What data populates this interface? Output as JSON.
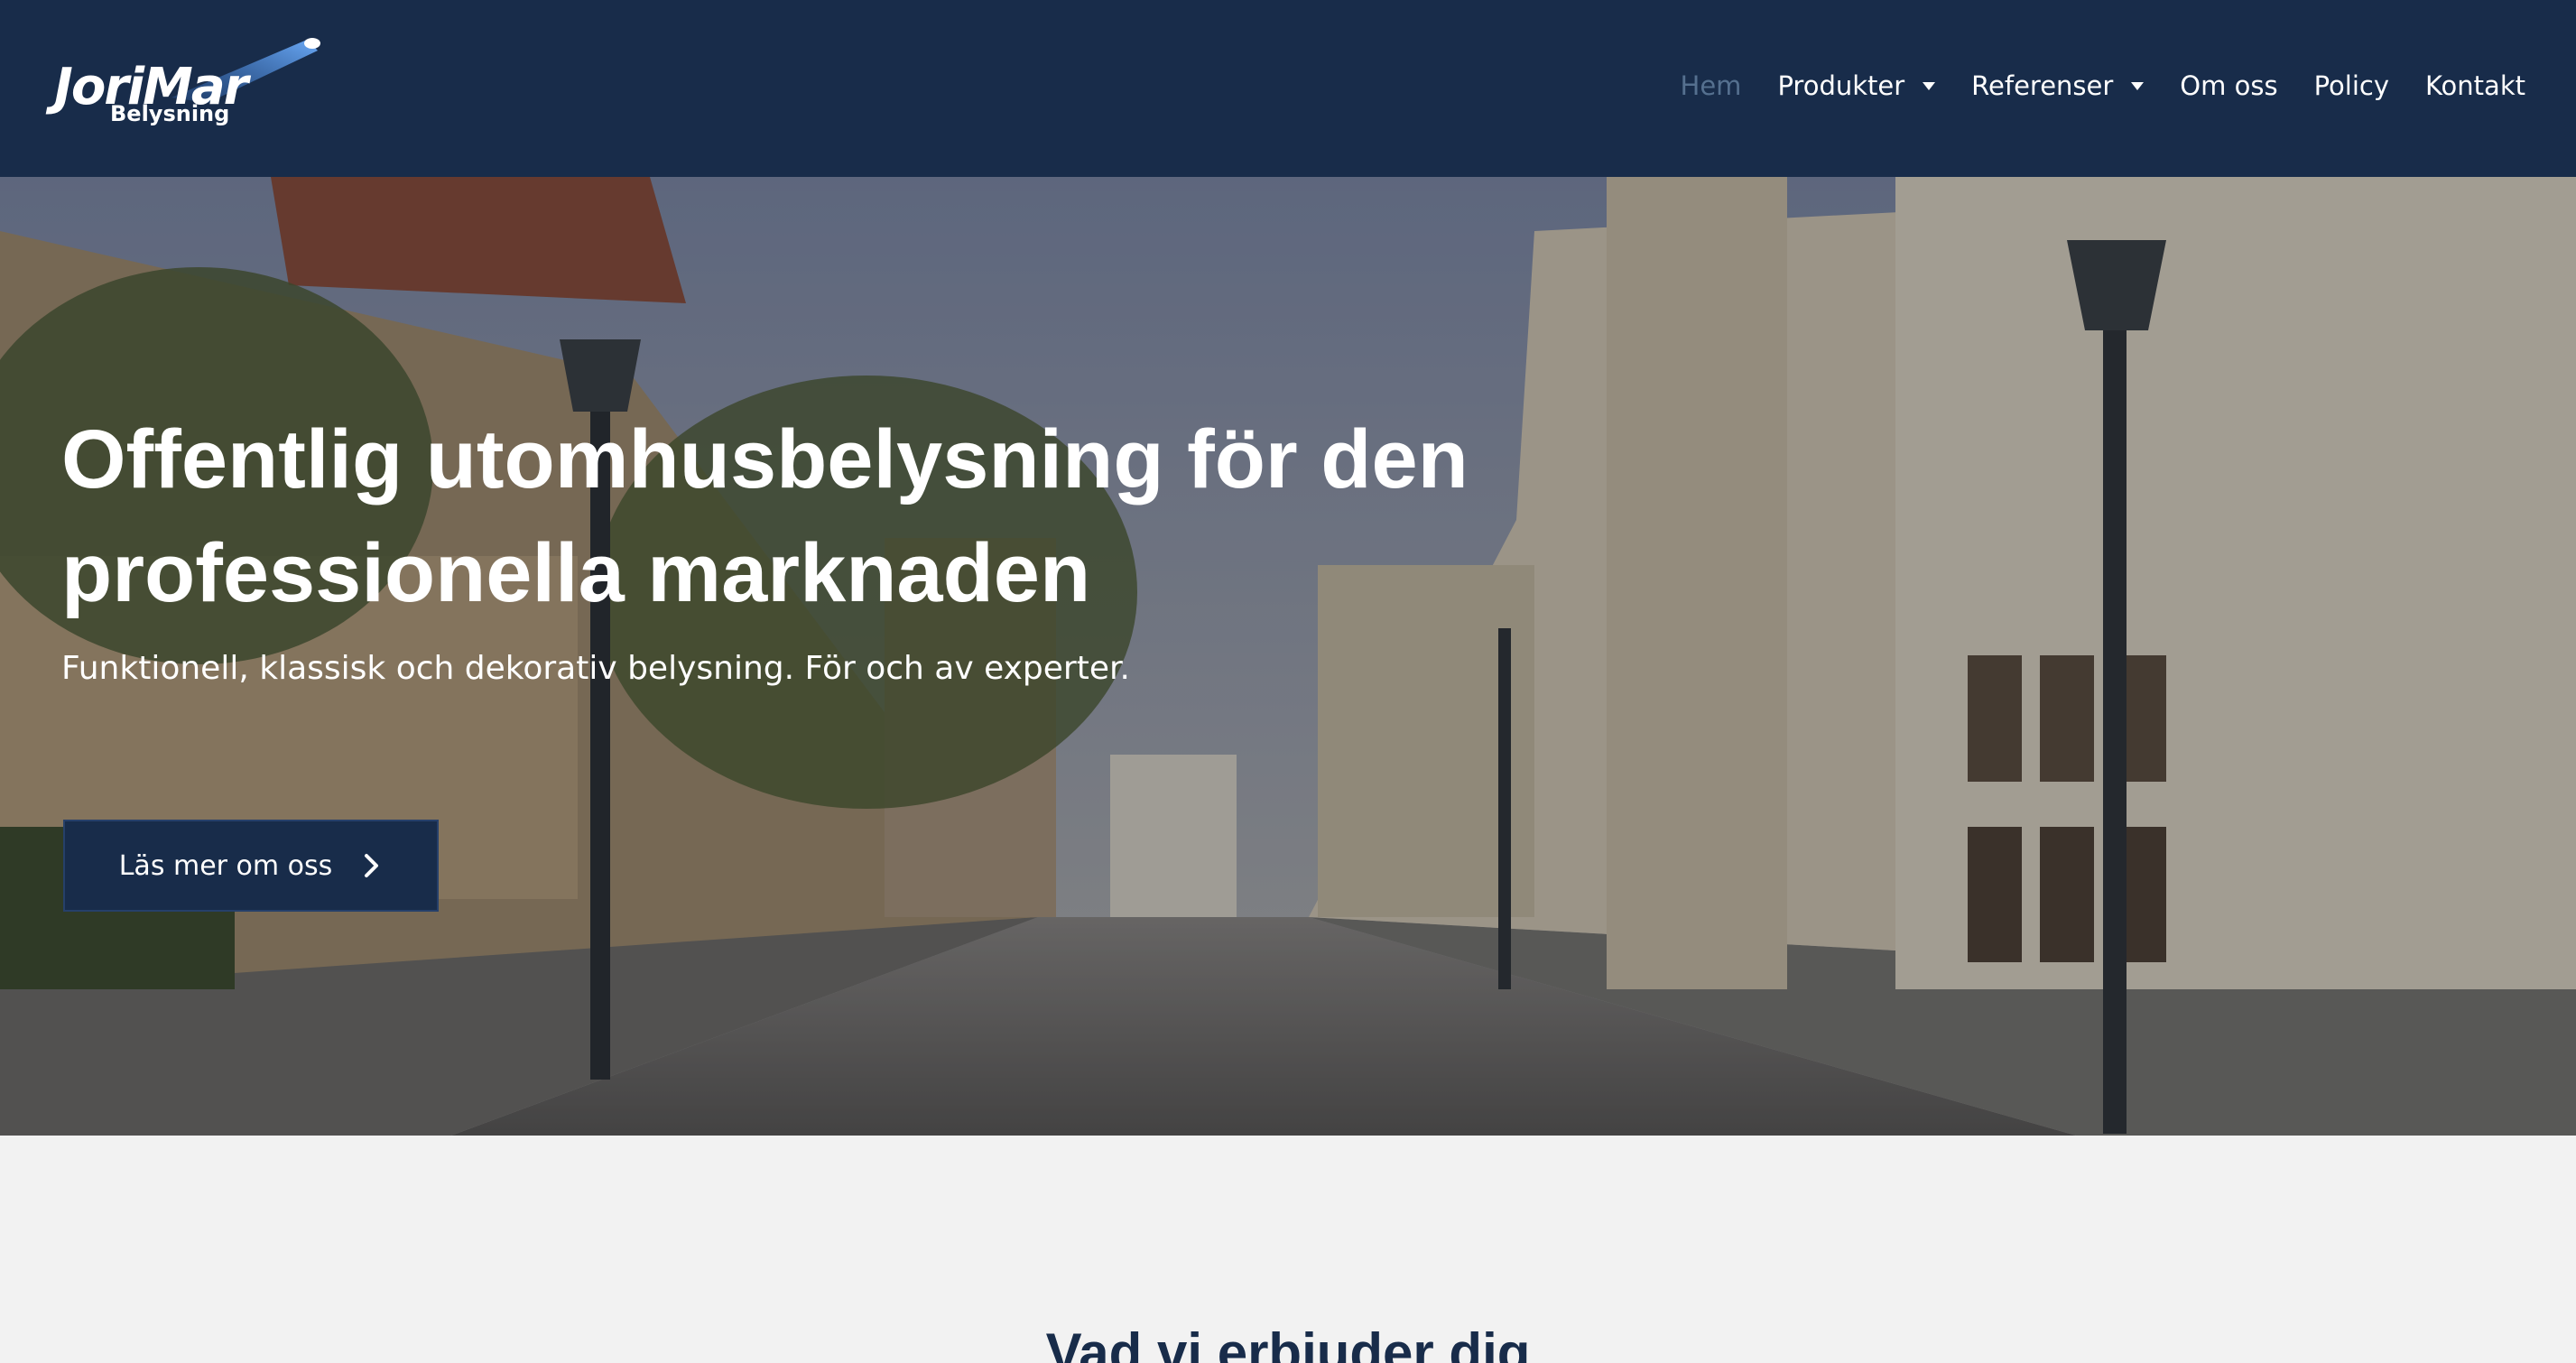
{
  "brand": {
    "name": "JoriMar",
    "tagline": "Belysning"
  },
  "nav": {
    "items": [
      {
        "label": "Hem",
        "active": true,
        "dropdown": false
      },
      {
        "label": "Produkter",
        "active": false,
        "dropdown": true
      },
      {
        "label": "Referenser",
        "active": false,
        "dropdown": true
      },
      {
        "label": "Om oss",
        "active": false,
        "dropdown": false
      },
      {
        "label": "Policy",
        "active": false,
        "dropdown": false
      },
      {
        "label": "Kontakt",
        "active": false,
        "dropdown": false
      }
    ]
  },
  "hero": {
    "title": "Offentlig utomhusbelysning för den professionella marknaden",
    "subtitle": "Funktionell, klassisk och dekorativ belysning. För och av experter.",
    "button_label": "Läs mer om oss",
    "button_icon": "chevron-right-icon"
  },
  "section": {
    "title": "Vad vi erbjuder dig"
  },
  "colors": {
    "header_bg": "#182c4a",
    "nav_active": "#55708f",
    "nav_text": "#ffffff",
    "button_bg": "#182c4a",
    "page_bg": "#f2f2f2"
  }
}
